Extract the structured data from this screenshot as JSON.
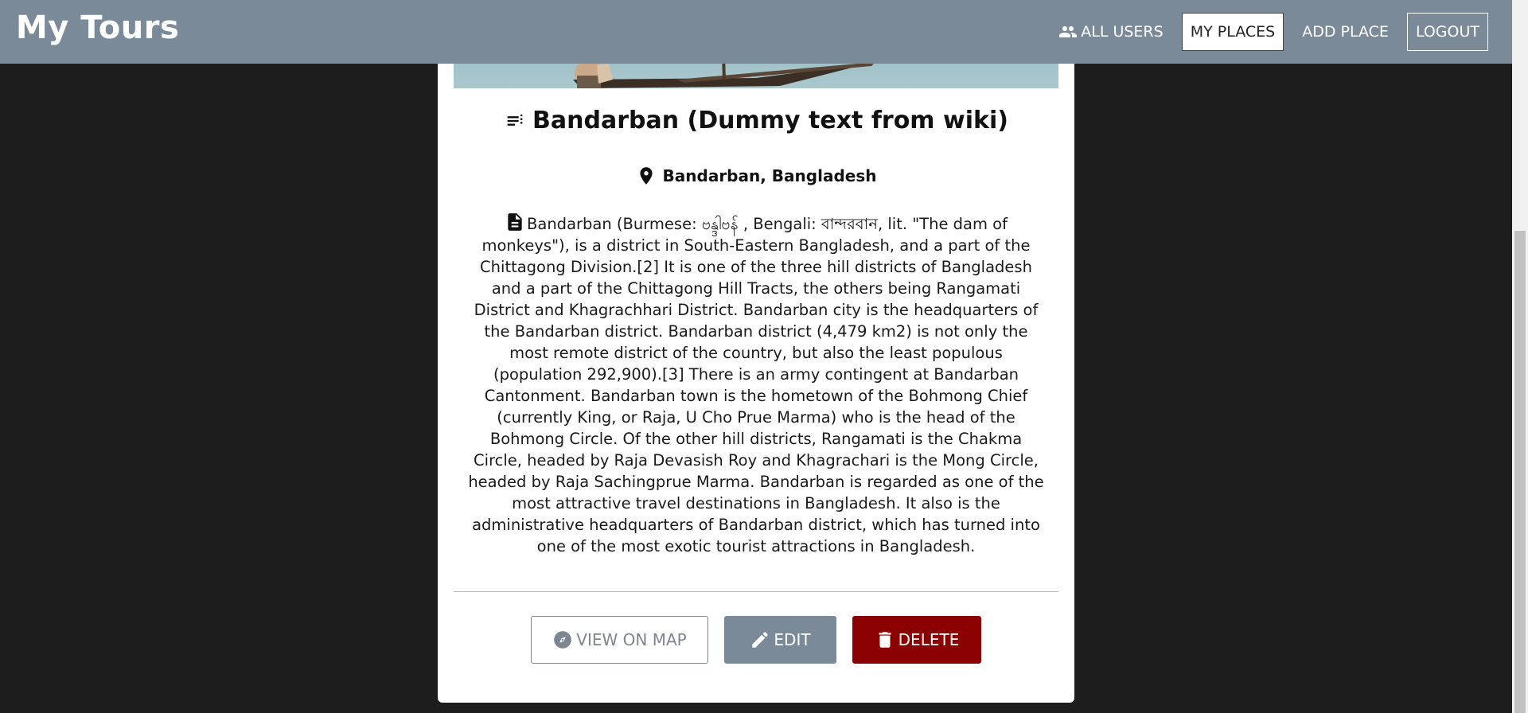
{
  "header": {
    "brand": "My Tours",
    "nav": {
      "all_users": "ALL USERS",
      "my_places": "MY PLACES",
      "add_place": "ADD PLACE",
      "logout": "LOGOUT"
    },
    "background_color": "#7b8a99"
  },
  "place": {
    "title": "Bandarban (Dummy text from wiki)",
    "location": "Bandarban, Bangladesh",
    "description": "Bandarban (Burmese: ဗန္ဒါဗန် , Bengali: বান্দরবান, lit. \"The dam of monkeys\"), is a district in South-Eastern Bangladesh, and a part of the Chittagong Division.[2] It is one of the three hill districts of Bangladesh and a part of the Chittagong Hill Tracts, the others being Rangamati District and Khagrachhari District. Bandarban city is the headquarters of the Bandarban district. Bandarban district (4,479 km2) is not only the most remote district of the country, but also the least populous (population 292,900).[3] There is an army contingent at Bandarban Cantonment. Bandarban town is the hometown of the Bohmong Chief (currently King, or Raja, U Cho Prue Marma) who is the head of the Bohmong Circle. Of the other hill districts, Rangamati is the Chakma Circle, headed by Raja Devasish Roy and Khagrachari is the Mong Circle, headed by Raja Sachingprue Marma. Bandarban is regarded as one of the most attractive travel destinations in Bangladesh. It also is the administrative headquarters of Bandarban district, which has turned into one of the most exotic tourist attractions in Bangladesh."
  },
  "actions": {
    "view_on_map": "VIEW ON MAP",
    "edit": "EDIT",
    "delete": "DELETE"
  },
  "colors": {
    "page_background": "#1d1d1d",
    "card_background": "#ffffff",
    "edit_button": "#7b8a99",
    "delete_button": "#8b0000"
  },
  "icons": {
    "all_users": "people-icon",
    "title": "notes-icon",
    "location": "location-pin-icon",
    "description": "document-icon",
    "view_on_map": "compass-icon",
    "edit": "pencil-icon",
    "delete": "trash-icon"
  }
}
